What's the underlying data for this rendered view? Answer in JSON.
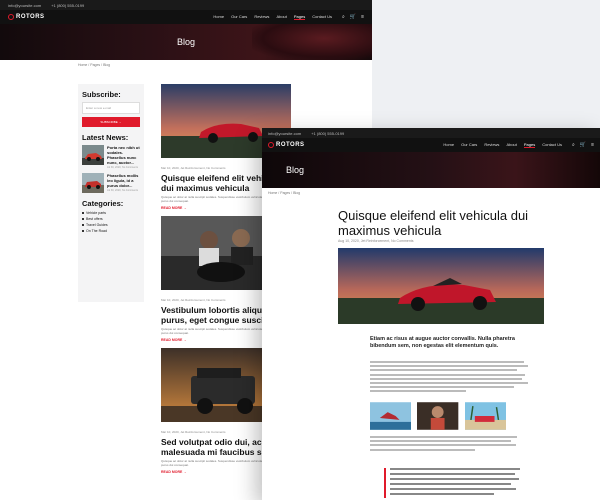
{
  "brand": {
    "name": "ROTORS",
    "accent": "#e01a2b"
  },
  "back": {
    "topbar": {
      "email": "info@yoursite.com",
      "phone": "+1 (800) 555-0199"
    },
    "nav": [
      "Home",
      "Our Cars",
      "Reviews",
      "About",
      "Pages",
      "Contact Us"
    ],
    "active_nav": "Pages",
    "hero_title": "Blog",
    "breadcrumb": "Home / Pages / Blog",
    "sidebar": {
      "subscribe_title": "Subscribe:",
      "email_placeholder": "Enter a new e-mail",
      "subscribe_button": "SUBSCRIBE",
      "latest_title": "Latest News:",
      "news": [
        {
          "title": "Porta nec nibh ut sodales. Phasellus nunc nunc, auctor...",
          "meta": "Jul 30, 2020, No Comments"
        },
        {
          "title": "Phasellus mollis leo ligula, id a purus dolor...",
          "meta": "Jul 30, 2020, No Comments"
        }
      ],
      "categories_title": "Categories:",
      "categories": [
        "Vehicle parts",
        "Best offers",
        "Travel Guides",
        "On The Road"
      ]
    },
    "posts": [
      {
        "meta": "Mar 10, 2020, Jet Reinforcement, No Comments",
        "title": "Quisque eleifend elit vehicula dui maximus vehicula",
        "excerpt": "Quisque ac dolor at nulla suscipit sodales. Suspendisse vestibulum vehicula. Praesent nec nibh purus dui consequat.",
        "read_more": "READ MORE"
      },
      {
        "meta": "Mar 10, 2020, Jet Reinforcement, No Comments",
        "title": "Vestibulum lobortis aliquam purus, eget congue suscipit",
        "excerpt": "Quisque ac dolor at nulla suscipit sodales. Suspendisse vestibulum vehicula. Praesent nec nibh purus dui consequat.",
        "read_more": "READ MORE"
      },
      {
        "meta": "Mar 10, 2020, Jet Reinforcement, No Comments",
        "title": "Sed volutpat odio dui, ac malesuada mi faucibus sed",
        "excerpt": "Quisque ac dolor at nulla suscipit sodales. Suspendisse vestibulum vehicula. Praesent nec nibh purus dui consequat.",
        "read_more": "READ MORE"
      }
    ]
  },
  "front": {
    "topbar": {
      "email": "info@yoursite.com",
      "phone": "+1 (800) 555-0199"
    },
    "nav": [
      "Home",
      "Our Cars",
      "Reviews",
      "About",
      "Pages",
      "Contact Us"
    ],
    "active_nav": "Pages",
    "hero_title": "Blog",
    "breadcrumb": "Home / Pages / Blog",
    "article": {
      "title": "Quisque eleifend elit vehicula dui maximus vehicula",
      "meta": "Aug 10, 2020, Jet Reinforcement, No Comments",
      "lead": "Etiam ac risus at augue auctor convallis. Nulla pharetra bibendum sem, non egestas elit elementum quis."
    }
  }
}
